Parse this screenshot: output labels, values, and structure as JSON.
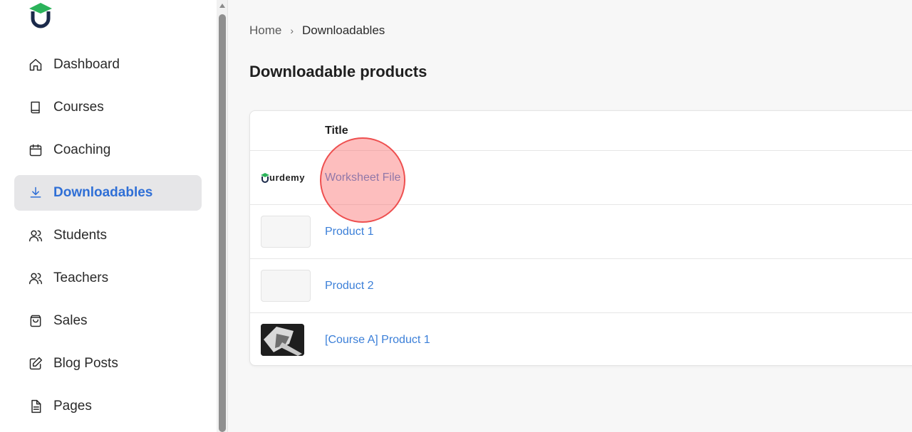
{
  "sidebar": {
    "items": [
      {
        "label": "Dashboard",
        "icon": "home-icon"
      },
      {
        "label": "Courses",
        "icon": "book-icon"
      },
      {
        "label": "Coaching",
        "icon": "calendar-icon"
      },
      {
        "label": "Downloadables",
        "icon": "download-icon",
        "active": true
      },
      {
        "label": "Students",
        "icon": "users-icon"
      },
      {
        "label": "Teachers",
        "icon": "users-icon"
      },
      {
        "label": "Sales",
        "icon": "bag-icon"
      },
      {
        "label": "Blog Posts",
        "icon": "edit-icon"
      },
      {
        "label": "Pages",
        "icon": "file-icon"
      }
    ]
  },
  "breadcrumb": {
    "home": "Home",
    "separator": "›",
    "current": "Downloadables"
  },
  "page": {
    "title": "Downloadable products"
  },
  "table": {
    "header": {
      "title": "Title"
    },
    "rows": [
      {
        "title": "Worksheet File",
        "thumb_text": "urdemy",
        "thumb": "logo"
      },
      {
        "title": "Product 1",
        "thumb": "placeholder"
      },
      {
        "title": "Product 2",
        "thumb": "placeholder"
      },
      {
        "title": "[Course A] Product 1",
        "thumb": "image"
      }
    ]
  },
  "colors": {
    "accent": "#2f6fd6",
    "link": "#3b7fd8",
    "logo_green": "#2bb35a",
    "logo_navy": "#1b2a4a",
    "click_marker": "#f06a6a"
  }
}
